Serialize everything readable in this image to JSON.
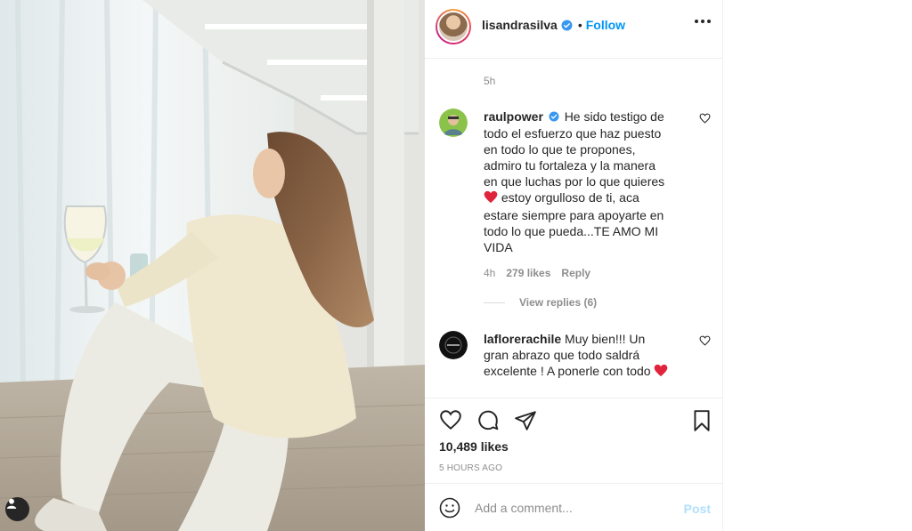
{
  "post": {
    "author": {
      "username": "lisandrasilva",
      "verified": true,
      "follow_separator": "•",
      "follow_label": "Follow"
    },
    "more_icon": "more-horizontal-icon",
    "previous_comment_time": "5h",
    "comments": [
      {
        "username": "raulpower",
        "verified": true,
        "text": "He sido testigo de todo el esfuerzo que haz puesto en todo lo que te propones, admiro tu fortaleza y la manera en que luchas por lo que quieres",
        "emoji_mid": "heart-emoji",
        "text_after": "estoy orgulloso de ti, aca estare siempre para apoyarte en todo lo que pueda...TE AMO MI VIDA",
        "time": "4h",
        "likes": "279 likes",
        "reply_label": "Reply",
        "view_replies": "View replies (6)"
      },
      {
        "username": "laflorerachile",
        "verified": false,
        "text": "Muy bien!!! Un gran abrazo que todo saldrá excelente ! A ponerle con todo",
        "emoji_end": "heart-emoji"
      }
    ],
    "likes_count": "10,489 likes",
    "posted_ago": "5 HOURS AGO",
    "add_comment_placeholder": "Add a comment...",
    "post_label": "Post"
  },
  "colors": {
    "link_blue": "#0095f6",
    "post_disabled": "#b2dffc",
    "muted": "#8e8e8e",
    "text": "#262626",
    "heart_red": "#ed4956"
  }
}
